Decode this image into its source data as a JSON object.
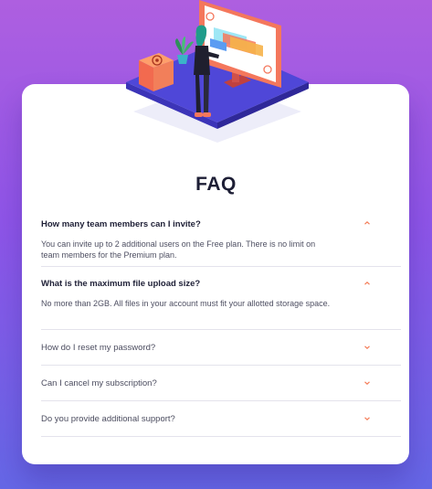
{
  "faq": {
    "title": "FAQ",
    "items": [
      {
        "question": "How many team members can I invite?",
        "answer": "You can invite up to 2 additional users on the Free plan. There is no limit on team members for the Premium plan.",
        "open": true
      },
      {
        "question": "What is the maximum file upload size?",
        "answer": "No more than 2GB. All files in your account must fit your allotted storage space.",
        "open": true
      },
      {
        "question": "How do I reset my password?",
        "answer": "",
        "open": false
      },
      {
        "question": "Can I cancel my subscription?",
        "answer": "",
        "open": false
      },
      {
        "question": "Do you provide additional support?",
        "answer": "",
        "open": false
      }
    ]
  },
  "colors": {
    "background_top": "#ae5fe0",
    "background_bottom": "#6567e6",
    "accent": "#f47c57",
    "heading": "#1d1e35",
    "text": "#4e4f62",
    "divider": "#e4e3ec"
  },
  "icons": {
    "chevron": "chevron-down-icon",
    "illustration": "woman-at-computer-illustration"
  }
}
